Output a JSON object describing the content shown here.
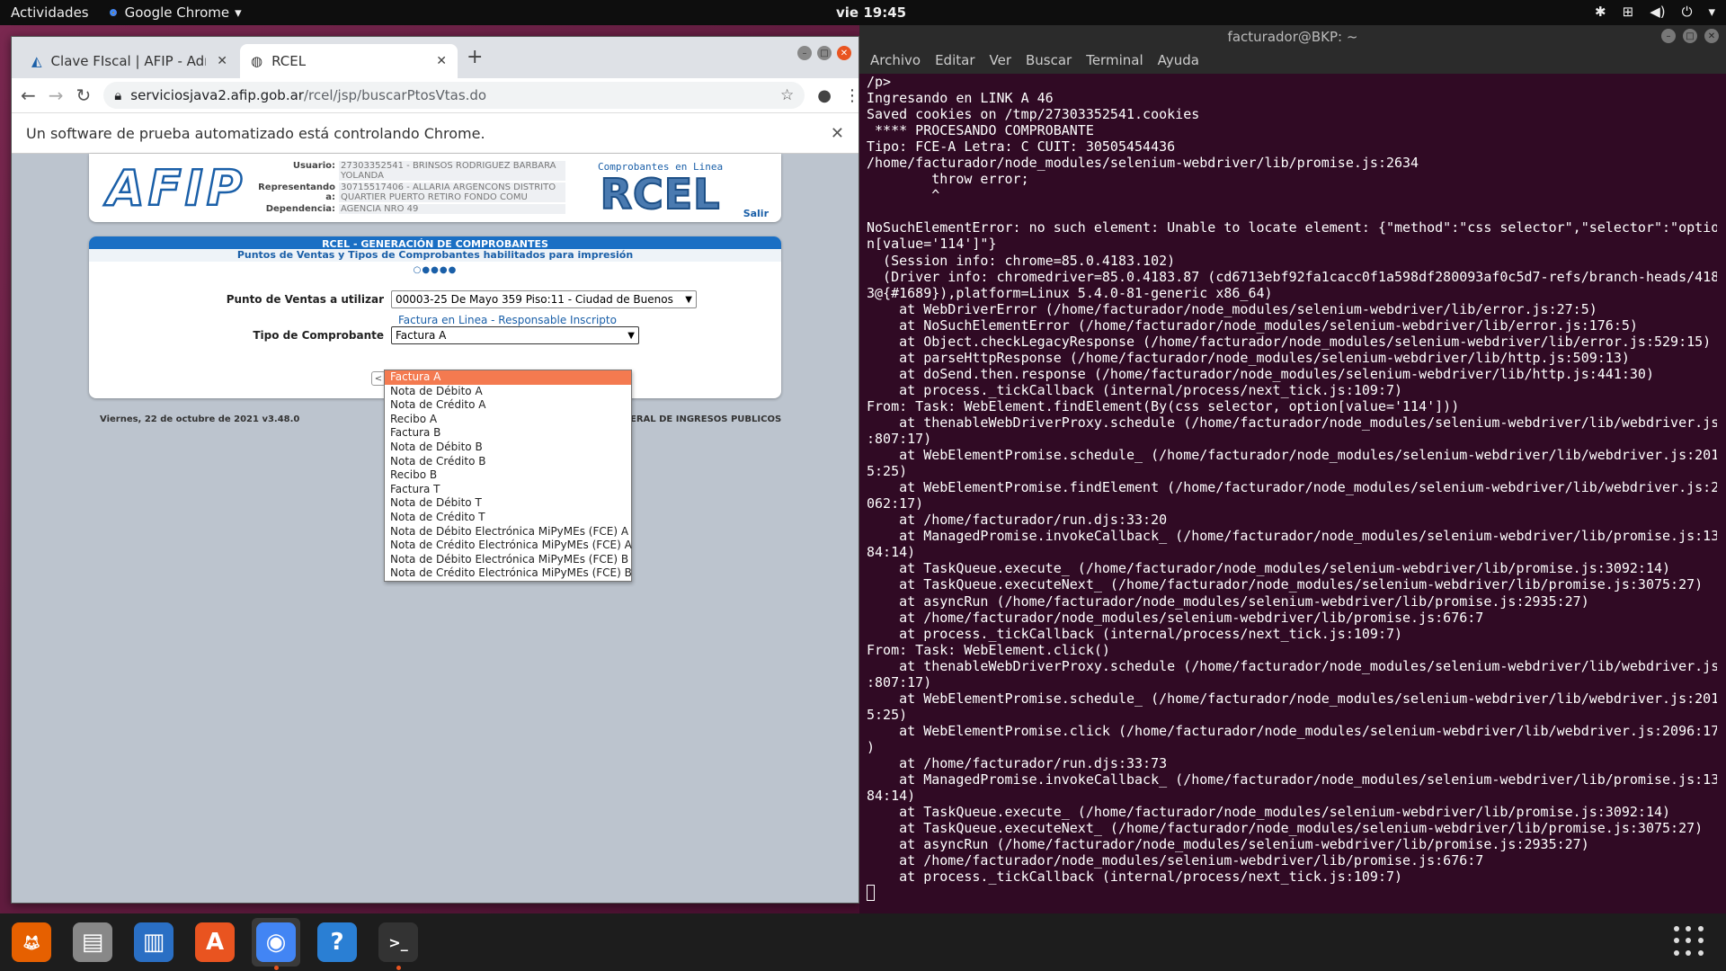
{
  "topbar": {
    "activities": "Actividades",
    "app_name": "Google Chrome",
    "clock": "vie 19:45"
  },
  "chrome": {
    "tabs": [
      {
        "label": "Clave FIscal | AFIP - Admin"
      },
      {
        "label": "RCEL"
      }
    ],
    "url_host": "serviciosjava2.afip.gob.ar",
    "url_path": "/rcel/jsp/buscarPtosVtas.do",
    "infobar": "Un software de prueba automatizado está controlando Chrome."
  },
  "afip": {
    "logo": "AFIP",
    "user_label": "Usuario:",
    "user_value": "27303352541 - BRINSOS RODRIGUEZ BARBARA YOLANDA",
    "rep_label": "Representando a:",
    "rep_value": "30715517406 - ALLARIA ARGENCONS DISTRITO QUARTIER PUERTO RETIRO FONDO COMU",
    "dep_label": "Dependencia:",
    "dep_value": "AGENCIA NRO 49",
    "rcel_sub": "Comprobantes en Linea",
    "rcel_big": "RCEL",
    "salir": "Salir",
    "panel_title": "RCEL - GENERACIÓN DE COMPROBANTES",
    "panel_subtitle": "Puntos de Ventas y Tipos de Comprobantes habilitados para impresión",
    "steps": "○●●●●",
    "pv_label": "Punto de Ventas a utilizar",
    "pv_value": "00003-25 De Mayo 359 Piso:11 - Ciudad de Buenos Aires",
    "pv_help": "Factura en Linea - Responsable Inscripto",
    "tipo_label": "Tipo de Comprobante",
    "tipo_value": "Factura A",
    "footer_date": "Viernes, 22 de octubre de 2021 v3.48.0",
    "footer_org": "ERAL DE INGRESOS PUBLICOS",
    "options": [
      "Factura A",
      "Nota de Débito A",
      "Nota de Crédito A",
      "Recibo A",
      "Factura B",
      "Nota de Débito B",
      "Nota de Crédito B",
      "Recibo B",
      "Factura T",
      "Nota de Débito T",
      "Nota de Crédito T",
      "Nota de Débito Electrónica MiPyMEs (FCE) A",
      "Nota de Crédito Electrónica MiPyMEs (FCE) A",
      "Nota de Débito Electrónica MiPyMEs (FCE) B",
      "Nota de Crédito Electrónica MiPyMEs (FCE) B"
    ]
  },
  "terminal": {
    "title": "facturador@BKP: ~",
    "menu": [
      "Archivo",
      "Editar",
      "Ver",
      "Buscar",
      "Terminal",
      "Ayuda"
    ],
    "lines": [
      "/p>",
      "Ingresando en LINK A 46",
      "Saved cookies on /tmp/27303352541.cookies",
      " **** PROCESANDO COMPROBANTE",
      "Tipo: FCE-A Letra: C CUIT: 30505454436",
      "/home/facturador/node_modules/selenium-webdriver/lib/promise.js:2634",
      "        throw error;",
      "        ^",
      "",
      "NoSuchElementError: no such element: Unable to locate element: {\"method\":\"css selector\",\"selector\":\"optio",
      "n[value='114']\"}",
      "  (Session info: chrome=85.0.4183.102)",
      "  (Driver info: chromedriver=85.0.4183.87 (cd6713ebf92fa1cacc0f1a598df280093af0c5d7-refs/branch-heads/418",
      "3@{#1689}),platform=Linux 5.4.0-81-generic x86_64)",
      "    at WebDriverError (/home/facturador/node_modules/selenium-webdriver/lib/error.js:27:5)",
      "    at NoSuchElementError (/home/facturador/node_modules/selenium-webdriver/lib/error.js:176:5)",
      "    at Object.checkLegacyResponse (/home/facturador/node_modules/selenium-webdriver/lib/error.js:529:15)",
      "    at parseHttpResponse (/home/facturador/node_modules/selenium-webdriver/lib/http.js:509:13)",
      "    at doSend.then.response (/home/facturador/node_modules/selenium-webdriver/lib/http.js:441:30)",
      "    at process._tickCallback (internal/process/next_tick.js:109:7)",
      "From: Task: WebElement.findElement(By(css selector, option[value='114']))",
      "    at thenableWebDriverProxy.schedule (/home/facturador/node_modules/selenium-webdriver/lib/webdriver.js",
      ":807:17)",
      "    at WebElementPromise.schedule_ (/home/facturador/node_modules/selenium-webdriver/lib/webdriver.js:201",
      "5:25)",
      "    at WebElementPromise.findElement (/home/facturador/node_modules/selenium-webdriver/lib/webdriver.js:2",
      "062:17)",
      "    at /home/facturador/run.djs:33:20",
      "    at ManagedPromise.invokeCallback_ (/home/facturador/node_modules/selenium-webdriver/lib/promise.js:13",
      "84:14)",
      "    at TaskQueue.execute_ (/home/facturador/node_modules/selenium-webdriver/lib/promise.js:3092:14)",
      "    at TaskQueue.executeNext_ (/home/facturador/node_modules/selenium-webdriver/lib/promise.js:3075:27)",
      "    at asyncRun (/home/facturador/node_modules/selenium-webdriver/lib/promise.js:2935:27)",
      "    at /home/facturador/node_modules/selenium-webdriver/lib/promise.js:676:7",
      "    at process._tickCallback (internal/process/next_tick.js:109:7)",
      "From: Task: WebElement.click()",
      "    at thenableWebDriverProxy.schedule (/home/facturador/node_modules/selenium-webdriver/lib/webdriver.js",
      ":807:17)",
      "    at WebElementPromise.schedule_ (/home/facturador/node_modules/selenium-webdriver/lib/webdriver.js:201",
      "5:25)",
      "    at WebElementPromise.click (/home/facturador/node_modules/selenium-webdriver/lib/webdriver.js:2096:17",
      ")",
      "    at /home/facturador/run.djs:33:73",
      "    at ManagedPromise.invokeCallback_ (/home/facturador/node_modules/selenium-webdriver/lib/promise.js:13",
      "84:14)",
      "    at TaskQueue.execute_ (/home/facturador/node_modules/selenium-webdriver/lib/promise.js:3092:14)",
      "    at TaskQueue.executeNext_ (/home/facturador/node_modules/selenium-webdriver/lib/promise.js:3075:27)",
      "    at asyncRun (/home/facturador/node_modules/selenium-webdriver/lib/promise.js:2935:27)",
      "    at /home/facturador/node_modules/selenium-webdriver/lib/promise.js:676:7",
      "    at process._tickCallback (internal/process/next_tick.js:109:7)"
    ]
  },
  "dock": {
    "items": [
      "firefox-icon",
      "files-icon",
      "writer-icon",
      "software-icon",
      "chrome-icon",
      "help-icon",
      "terminal-icon"
    ]
  }
}
